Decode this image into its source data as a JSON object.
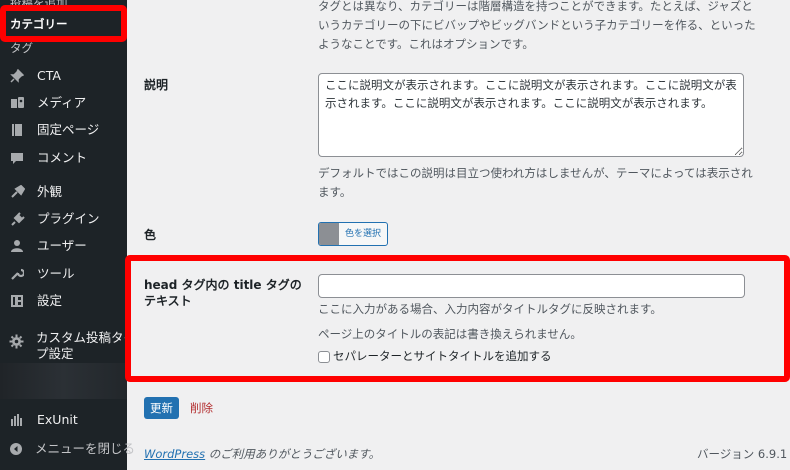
{
  "sidebar": {
    "sub_add_new": "投稿を追加",
    "sub_category": "カテゴリー",
    "sub_tag": "タグ",
    "items": [
      {
        "label": "CTA",
        "icon": "pin-icon"
      },
      {
        "label": "メディア",
        "icon": "media-icon"
      },
      {
        "label": "固定ページ",
        "icon": "page-icon"
      },
      {
        "label": "コメント",
        "icon": "comment-icon"
      },
      {
        "label": "外観",
        "icon": "appearance-icon"
      },
      {
        "label": "プラグイン",
        "icon": "plugin-icon"
      },
      {
        "label": "ユーザー",
        "icon": "user-icon"
      },
      {
        "label": "ツール",
        "icon": "tools-icon"
      },
      {
        "label": "設定",
        "icon": "settings-icon"
      },
      {
        "label": "カスタム投稿タイプ設定",
        "label_line1": "カスタム投稿タイ",
        "label_line2": "プ設定",
        "icon": "gear-icon"
      },
      {
        "label": "ExUnit",
        "icon": "exunit-icon"
      },
      {
        "label": "メニューを閉じる",
        "icon": "collapse-icon"
      }
    ]
  },
  "form": {
    "parent_desc": [
      "タグとは異なり、カテゴリーは階層構造を持つことができます。たとえば、ジャズと",
      "いうカテゴリーの下にビバップやビッグバンドという子カテゴリーを作る、といった",
      "ようなことです。これはオプションです。"
    ],
    "description_label": "説明",
    "description_value": "ここに説明文が表示されます。ここに説明文が表示されます。ここに説明文が表示されます。ここに説明文が表示されます。ここに説明文が表示されます。",
    "description_help": [
      "デフォルトではこの説明は目立つ使われ方はしませんが、テーマによっては表示され",
      "ます。"
    ],
    "color_label": "色",
    "color_button": "色を選択",
    "title_tag_label_line1": "head タグ内の title タグの",
    "title_tag_label_line2": "テキスト",
    "title_tag_value": "",
    "title_tag_help1": "ここに入力がある場合、入力内容がタイトルタグに反映されます。",
    "title_tag_help2": "ページ上のタイトルの表記は書き換えられません。",
    "separator_checkbox_label": "セパレーターとサイトタイトルを追加する",
    "separator_checked": false,
    "update_button": "更新",
    "delete_link": "削除"
  },
  "footer": {
    "wordpress_link": "WordPress",
    "thanks": " のご利用ありがとうございます。",
    "version": "バージョン 6.9.1"
  },
  "colors": {
    "annotation": "#ff0000",
    "accent": "#2271b1",
    "sidebar_bg": "#1d2327",
    "delete": "#b32d2e"
  }
}
